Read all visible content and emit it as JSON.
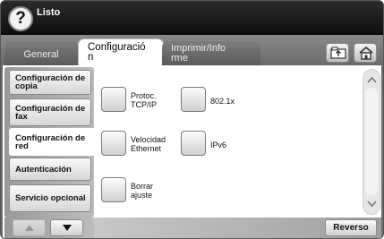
{
  "status": {
    "text": "Listo",
    "help_symbol": "?"
  },
  "tabs": [
    {
      "label": "General",
      "selected": false
    },
    {
      "label_line1": "Configuració",
      "label_line2": "n",
      "selected": true
    },
    {
      "label_line1": "Imprimir/Info",
      "label_line2": "rme",
      "selected": false
    }
  ],
  "toolbar_icons": [
    "folder-icon",
    "home-icon"
  ],
  "left_menu": {
    "items": [
      {
        "line1": "Configuración de",
        "line2": "copia"
      },
      {
        "line1": "Configuración de",
        "line2": "fax"
      },
      {
        "line1": "Configuración de",
        "line2": "red",
        "selected": true
      },
      {
        "line1": "Autenticación",
        "line2": ""
      },
      {
        "line1": "Servicio opcional",
        "line2": ""
      }
    ]
  },
  "options": [
    {
      "line1": "Protoc.",
      "line2": "TCP/IP"
    },
    {
      "line1": "802.1x",
      "line2": ""
    },
    {
      "line1": "Velocidad",
      "line2": "Ethernet"
    },
    {
      "line1": "IPv6",
      "line2": ""
    },
    {
      "line1": "Borrar",
      "line2": "ajuste"
    }
  ],
  "footer": {
    "back_label": "Reverso"
  },
  "colors": {
    "top_bar": "#1a1a1a",
    "tab_strip": "#7a7a7a",
    "content_bg": "#ffffff"
  }
}
